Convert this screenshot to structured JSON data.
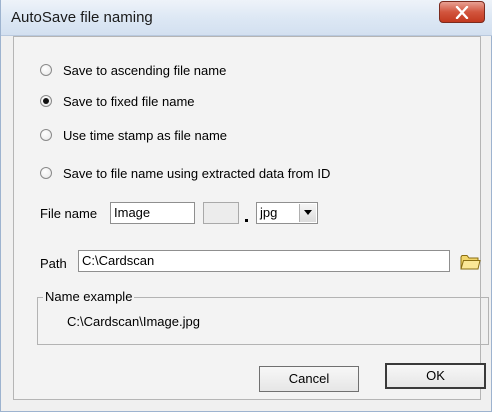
{
  "window": {
    "title": "AutoSave file naming",
    "close_glyph": "✕"
  },
  "options": [
    {
      "label": "Save to ascending file name",
      "checked": false
    },
    {
      "label": "Save to fixed file name",
      "checked": true
    },
    {
      "label": "Use time stamp as file  name",
      "checked": false
    },
    {
      "label": "Save to file name  using extracted data from ID",
      "checked": false
    }
  ],
  "file_name": {
    "label": "File name",
    "value": "Image",
    "suffix_value": "",
    "extension": "jpg"
  },
  "path": {
    "label": "Path",
    "value": "C:\\Cardscan",
    "browse_icon": "folder-icon"
  },
  "name_example": {
    "caption": "Name example",
    "value": "C:\\Cardscan\\Image.jpg"
  },
  "buttons": {
    "cancel": "Cancel",
    "ok": "OK"
  },
  "colors": {
    "close_button": "#d2553e",
    "titlebar": "#dce7f4",
    "client": "#f3f3f3"
  }
}
